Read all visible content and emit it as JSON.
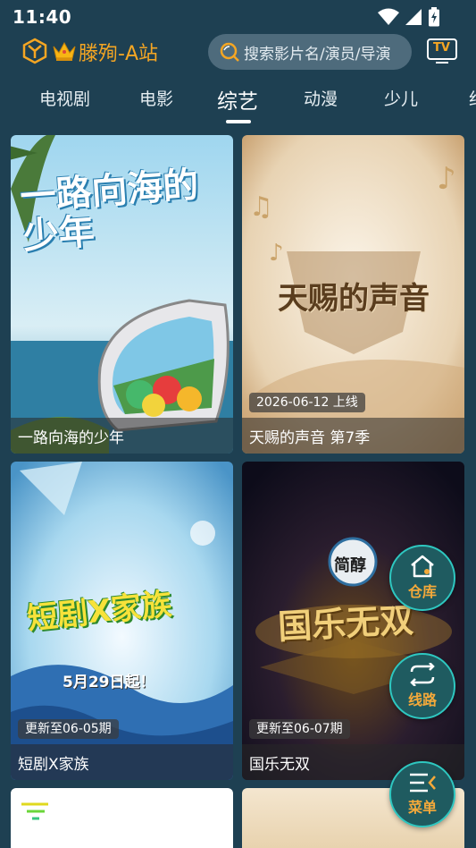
{
  "status_bar": {
    "time": "11:40"
  },
  "header": {
    "app_title": "滕殉-A站",
    "search_placeholder": "搜索影片名/演员/导演",
    "tv_label": "TV"
  },
  "tabs": [
    {
      "label": "电视剧"
    },
    {
      "label": "电影"
    },
    {
      "label": "综艺",
      "active": true
    },
    {
      "label": "动漫"
    },
    {
      "label": "少儿"
    },
    {
      "label": "纪"
    }
  ],
  "cards": [
    {
      "title": "一路向海的少年",
      "poster_text": "一路向海的少年"
    },
    {
      "title": "天赐的声音 第7季",
      "badge": "2026-06-12 上线",
      "poster_text": "天赐的声音"
    },
    {
      "title": "短剧X家族",
      "badge": "更新至06-05期",
      "poster_text": "短剧X家族",
      "poster_sub": "5月29日起！"
    },
    {
      "title": "国乐无双",
      "badge": "更新至06-07期",
      "poster_text": "国乐无双",
      "poster_sub": "简醇"
    }
  ],
  "fabs": [
    {
      "label": "仓库",
      "icon": "house-icon"
    },
    {
      "label": "线路",
      "icon": "swap-icon"
    },
    {
      "label": "菜单",
      "icon": "menu-icon"
    }
  ],
  "colors": {
    "background": "#1e4052",
    "accent": "#f5a623",
    "fab_border": "#2ec7c0"
  }
}
